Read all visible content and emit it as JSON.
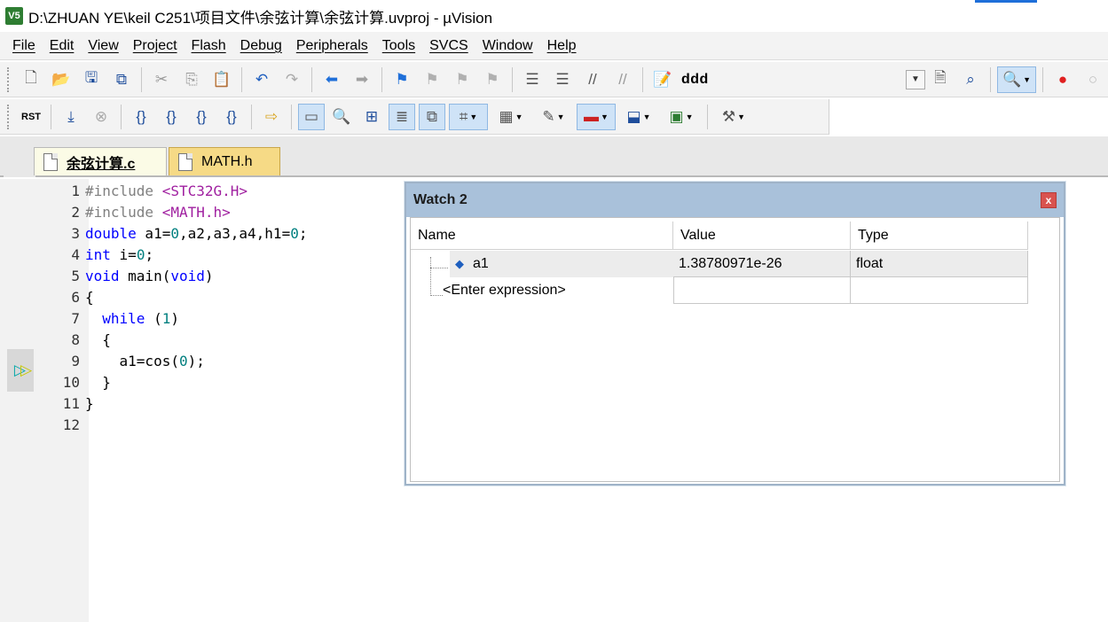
{
  "window": {
    "title": "D:\\ZHUAN YE\\keil C251\\项目文件\\余弦计算\\余弦计算.uvproj - µVision",
    "app_icon_label": "V5"
  },
  "menu": [
    "File",
    "Edit",
    "View",
    "Project",
    "Flash",
    "Debug",
    "Peripherals",
    "Tools",
    "SVCS",
    "Window",
    "Help"
  ],
  "toolbar": {
    "target_label": "ddd"
  },
  "tabs": [
    {
      "label": "余弦计算.c",
      "active": true
    },
    {
      "label": "MATH.h",
      "active": false
    }
  ],
  "editor": {
    "lines": [
      {
        "num": "1"
      },
      {
        "num": "2"
      },
      {
        "num": "3"
      },
      {
        "num": "4"
      },
      {
        "num": "5"
      },
      {
        "num": "6"
      },
      {
        "num": "7"
      },
      {
        "num": "8"
      },
      {
        "num": "9"
      },
      {
        "num": "10"
      },
      {
        "num": "11"
      },
      {
        "num": "12"
      }
    ],
    "code": {
      "l1_pp": "#include ",
      "l1_inc": "<STC32G.H>",
      "l2_pp": "#include ",
      "l2_inc": "<MATH.h>",
      "l3_kw": "double",
      "l3_rest_a": " a1=",
      "l3_n1": "0",
      "l3_rest_b": ",a2,a3,a4,h1=",
      "l3_n2": "0",
      "l3_end": ";",
      "l4_kw": "int",
      "l4_rest": " i=",
      "l4_n": "0",
      "l4_end": ";",
      "l5_kw": "void",
      "l5_rest": " main(",
      "l5_kw2": "void",
      "l5_end": ")",
      "l6": "{",
      "l7_indent": "  ",
      "l7_kw": "while",
      "l7_rest": " (",
      "l7_n": "1",
      "l7_end": ")",
      "l8": "  {",
      "l9_a": "    a1=cos(",
      "l9_n": "0",
      "l9_b": ");",
      "l10": "  }",
      "l11": "}",
      "l12": ""
    }
  },
  "watch": {
    "title": "Watch 2",
    "close_label": "x",
    "columns": [
      "Name",
      "Value",
      "Type"
    ],
    "rows": [
      {
        "name": "a1",
        "value": "1.38780971e-26",
        "type": "float"
      },
      {
        "name": "<Enter expression>",
        "value": "",
        "type": ""
      }
    ]
  }
}
